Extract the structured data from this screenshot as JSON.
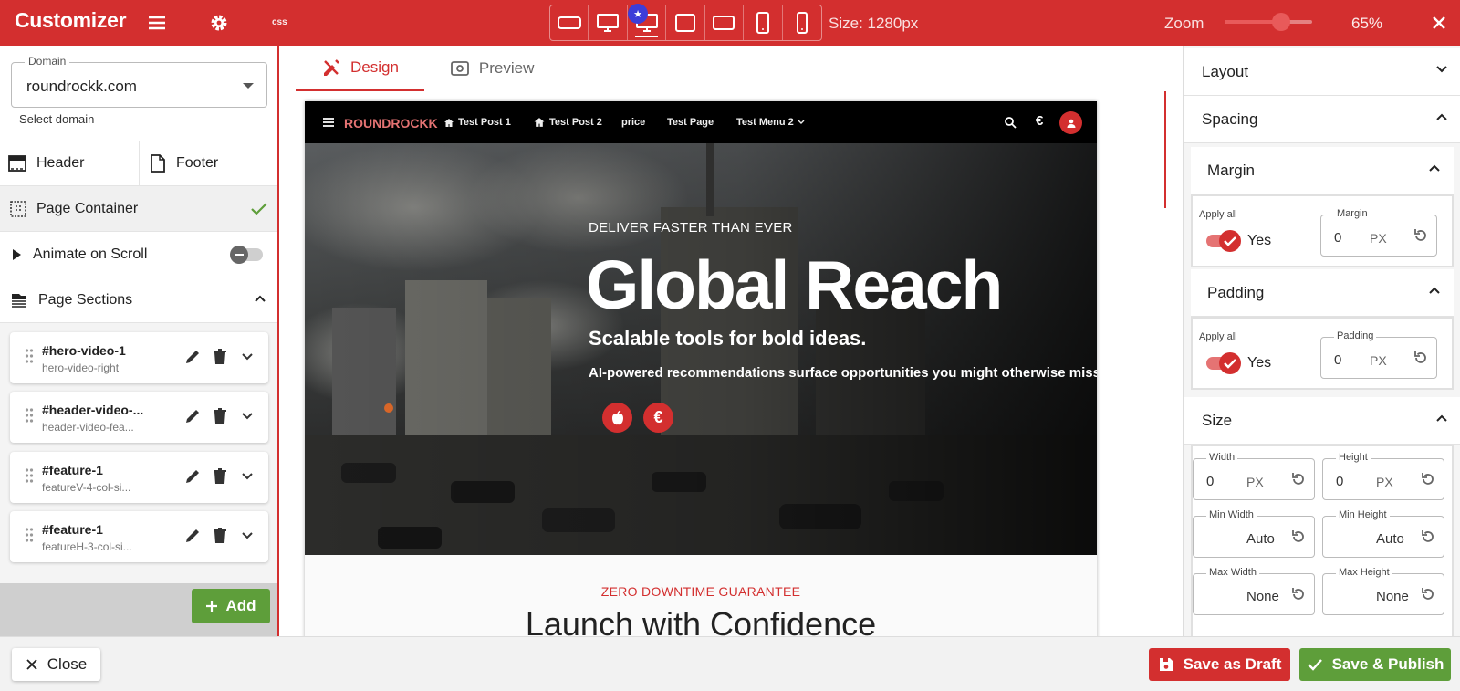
{
  "topbar": {
    "brand": "Customizer",
    "css_label": "css",
    "size_text": "Size: 1280px",
    "zoom_label": "Zoom",
    "zoom_value": "65%",
    "zoom_level": 0.65,
    "device_badge": "★",
    "accent": "#d32f2f"
  },
  "left": {
    "domain_legend": "Domain",
    "domain_value": "roundrockk.com",
    "domain_help": "Select domain",
    "header_label": "Header",
    "footer_label": "Footer",
    "page_container_label": "Page Container",
    "animate_label": "Animate on Scroll",
    "page_sections_label": "Page Sections",
    "sections": [
      {
        "title": "#hero-video-1",
        "subtitle": "hero-video-right"
      },
      {
        "title": "#header-video-...",
        "subtitle": "header-video-fea..."
      },
      {
        "title": "#feature-1",
        "subtitle": "featureV-4-col-si..."
      },
      {
        "title": "#feature-1",
        "subtitle": "featureH-3-col-si..."
      }
    ],
    "add_label": "Add"
  },
  "center": {
    "tab_design": "Design",
    "tab_preview": "Preview",
    "site": {
      "logo": "ROUNDROCKK",
      "nav": [
        "Test Post 1",
        "Test Post 2",
        "price",
        "Test Page",
        "Test Menu 2"
      ],
      "hero_eyebrow": "DELIVER FASTER THAN EVER",
      "hero_title": "Global Reach",
      "hero_subtitle": "Scalable tools for bold ideas.",
      "hero_desc": "AI-powered recommendations surface opportunities you might otherwise miss.",
      "hero_btn_euro": "€",
      "section_eyebrow": "ZERO DOWNTIME GUARANTEE",
      "section_title": "Launch with Confidence"
    }
  },
  "right": {
    "layout": "Layout",
    "spacing": "Spacing",
    "margin": "Margin",
    "padding": "Padding",
    "size": "Size",
    "apply_all": "Apply all",
    "yes": "Yes",
    "unit_px": "PX",
    "margin_field": {
      "label": "Margin",
      "value": "0"
    },
    "padding_field": {
      "label": "Padding",
      "value": "0"
    },
    "width": {
      "label": "Width",
      "value": "0"
    },
    "height": {
      "label": "Height",
      "value": "0"
    },
    "min_width": {
      "label": "Min Width",
      "value": "Auto"
    },
    "min_height": {
      "label": "Min Height",
      "value": "Auto"
    },
    "max_width": {
      "label": "Max Width",
      "value": "None"
    },
    "max_height": {
      "label": "Max Height",
      "value": "None"
    }
  },
  "bottom": {
    "close": "Close",
    "save_draft": "Save as Draft",
    "save_publish": "Save & Publish"
  }
}
